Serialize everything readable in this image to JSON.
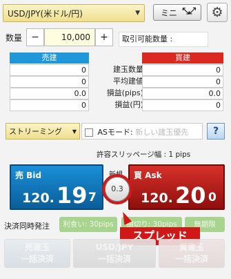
{
  "header": {
    "pair": "USD/JPY(米ドル/円)",
    "mini_label": "ミニ",
    "mini_icon": "collapse-arrows-icon",
    "settings_icon": "gear-icon"
  },
  "quantity": {
    "label": "数量",
    "minus": "−",
    "value": "10,000",
    "plus": "+",
    "available_label": "取引可能数量 :"
  },
  "positions": {
    "sell_header": "売建",
    "buy_header": "買建",
    "rows": [
      {
        "sell": "0",
        "label": "建玉数量",
        "buy": "0"
      },
      {
        "sell": "0",
        "label": "平均建値",
        "buy": "0"
      },
      {
        "sell": "0.0",
        "label": "損益(pips)",
        "buy": "0.0"
      },
      {
        "sell": "0",
        "label": "損益(円)",
        "buy": "0"
      }
    ]
  },
  "controls": {
    "stream_label": "ストリーミング",
    "as_label": "ASモード:",
    "as_placeholder": "新しい建玉優先",
    "help": "?",
    "slippage": "許容スリッページ幅 : 1 pips"
  },
  "prices": {
    "bid_label": "売 Bid",
    "bid_prefix": "120.",
    "bid_big": "19",
    "bid_tail": "7",
    "ask_label": "買 Ask",
    "ask_prefix": "120.",
    "ask_big": "20",
    "ask_tail": "0",
    "new_label": "新規",
    "spread": "0.3"
  },
  "settlement": {
    "label": "決済同時発注",
    "take_profit": "利食い: 30pips",
    "stop_loss": "損切り: 30pips",
    "unlimited": "無期限"
  },
  "annotation": {
    "callout": "スプレッド"
  },
  "bottom": {
    "sell_line1": "売建玉",
    "sell_line2": "一括決済",
    "all_line1": "USD/JPY",
    "all_line2": "一括決済",
    "buy_line1": "買建玉",
    "buy_line2": "一括決済"
  }
}
